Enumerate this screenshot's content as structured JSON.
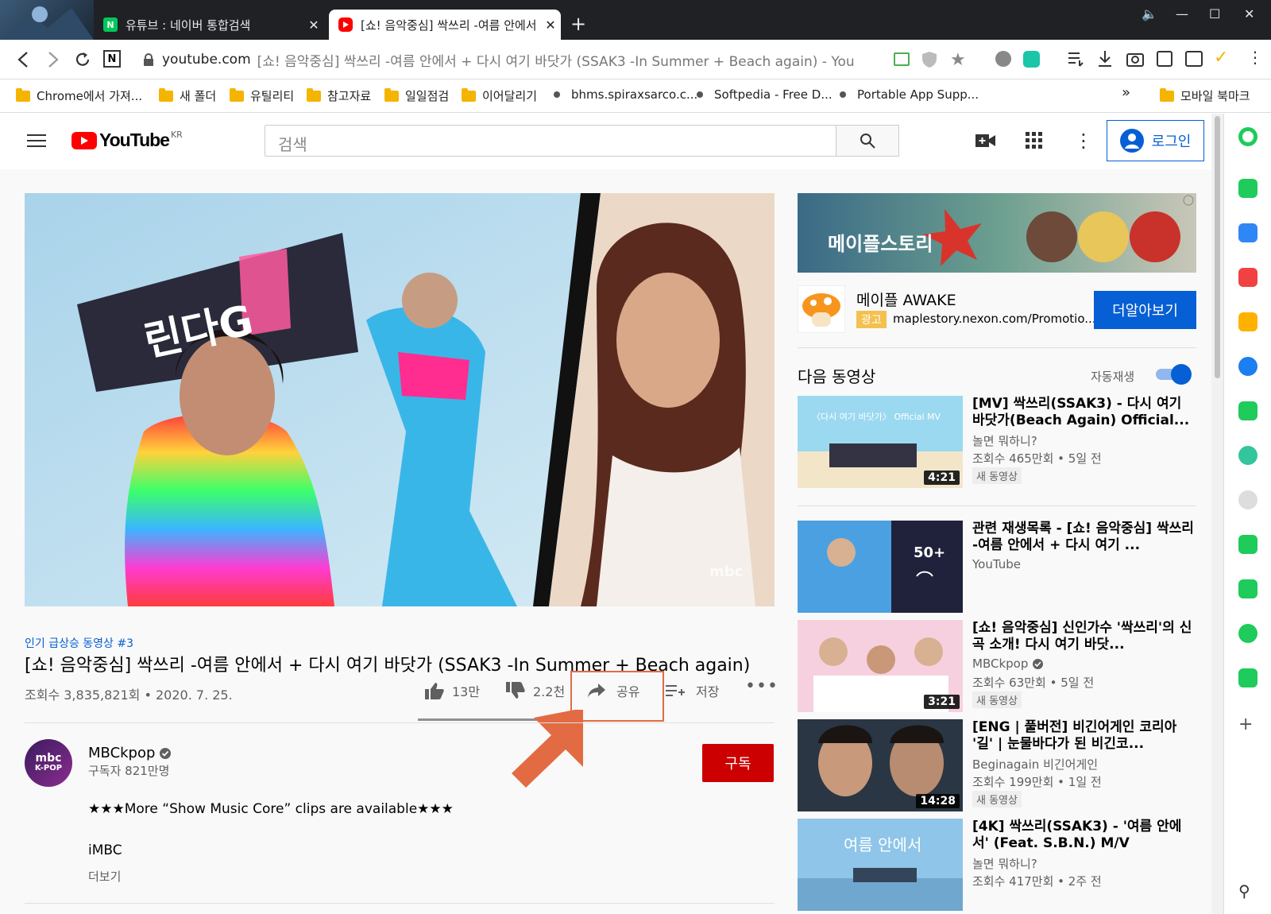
{
  "browser": {
    "tabs": [
      {
        "title": "유튜브 : 네이버 통합검색"
      },
      {
        "title": "[쇼! 음악중심] 싹쓰리 -여름 안에서"
      }
    ],
    "url_domain": "youtube.com",
    "url_rest": "[쇼! 음악중심] 싹쓰리 -여름 안에서 + 다시 여기 바닷가 (SSAK3 -In Summer + Beach again) - You",
    "bookmarks": [
      "Chrome에서 가져...",
      "새 폴더",
      "유틸리티",
      "참고자료",
      "일일점검",
      "이어달리기",
      "bhms.spiraxsarco.c...",
      "Softpedia - Free D...",
      "Portable App Supp...",
      "모바일 북마크"
    ],
    "more_bookmarks": "»"
  },
  "youtube": {
    "logo_text": "YouTube",
    "region": "KR",
    "search_placeholder": "검색",
    "login_label": "로그인"
  },
  "video": {
    "hashtag": "인기 급상승 동영상 #3",
    "title": "[쇼! 음악중심] 싹쓰리 -여름 안에서 + 다시 여기 바닷가 (SSAK3 -In Summer + Beach again)",
    "views_date": "조회수 3,835,821회 • 2020. 7. 25.",
    "likes": "13만",
    "dislikes": "2.2천",
    "share": "공유",
    "save": "저장",
    "watermark": "mbc",
    "thumb_text": "린다G"
  },
  "channel": {
    "avatar_line1": "mbc",
    "avatar_line2": "K-POP",
    "name": "MBCkpop",
    "subscribers": "구독자 821만명",
    "subscribe_label": "구독"
  },
  "description": {
    "line1": "★★★More “Show Music Core” clips are available★★★",
    "line2": "iMBC",
    "more": "더보기"
  },
  "ad": {
    "banner_text": "메이플스토리",
    "title": "메이플 AWAKE",
    "badge": "광고",
    "url": "maplestory.nexon.com/Promotio...",
    "cta": "더알아보기"
  },
  "upnext": {
    "heading": "다음 동영상",
    "autoplay": "자동재생"
  },
  "related": [
    {
      "title": "[MV] 싹쓰리(SSAK3) - 다시 여기 바닷가(Beach Again) Official...",
      "channel": "놀면 뭐하니?",
      "meta": "조회수 465만회 • 5일 전",
      "badge": "새 동영상",
      "duration": "4:21",
      "thumb_text": "〈다시 여기 바닷가〉 Official MV"
    },
    {
      "title": "관련 재생목록 - [쇼! 음악중심] 싹쓰리 -여름 안에서 + 다시 여기 ...",
      "channel": "YouTube",
      "playlist_count": "50+"
    },
    {
      "title": "[쇼! 음악중심] 신인가수 '싹쓰리'의 신곡 소개! 다시 여기 바닷...",
      "channel": "MBCkpop",
      "meta": "조회수 63만회 • 5일 전",
      "badge": "새 동영상",
      "duration": "3:21"
    },
    {
      "title": "[ENG | 풀버전] 비긴어게인 코리아 '길' | 눈물바다가 된 비긴코...",
      "channel": "Beginagain 비긴어게인",
      "meta": "조회수 199만회 • 1일 전",
      "badge": "새 동영상",
      "duration": "14:28"
    },
    {
      "title": "[4K] 싹쓰리(SSAK3) - '여름 안에서' (Feat. S.B.N.) M/V",
      "channel": "놀면 뭐하니?",
      "meta": "조회수 417만회 • 2주 전",
      "thumb_text": "여름 안에서"
    }
  ],
  "colors": {
    "accent_blue": "#065fd4",
    "subscribe_red": "#cc0000",
    "annotation_orange": "#e36b43"
  }
}
